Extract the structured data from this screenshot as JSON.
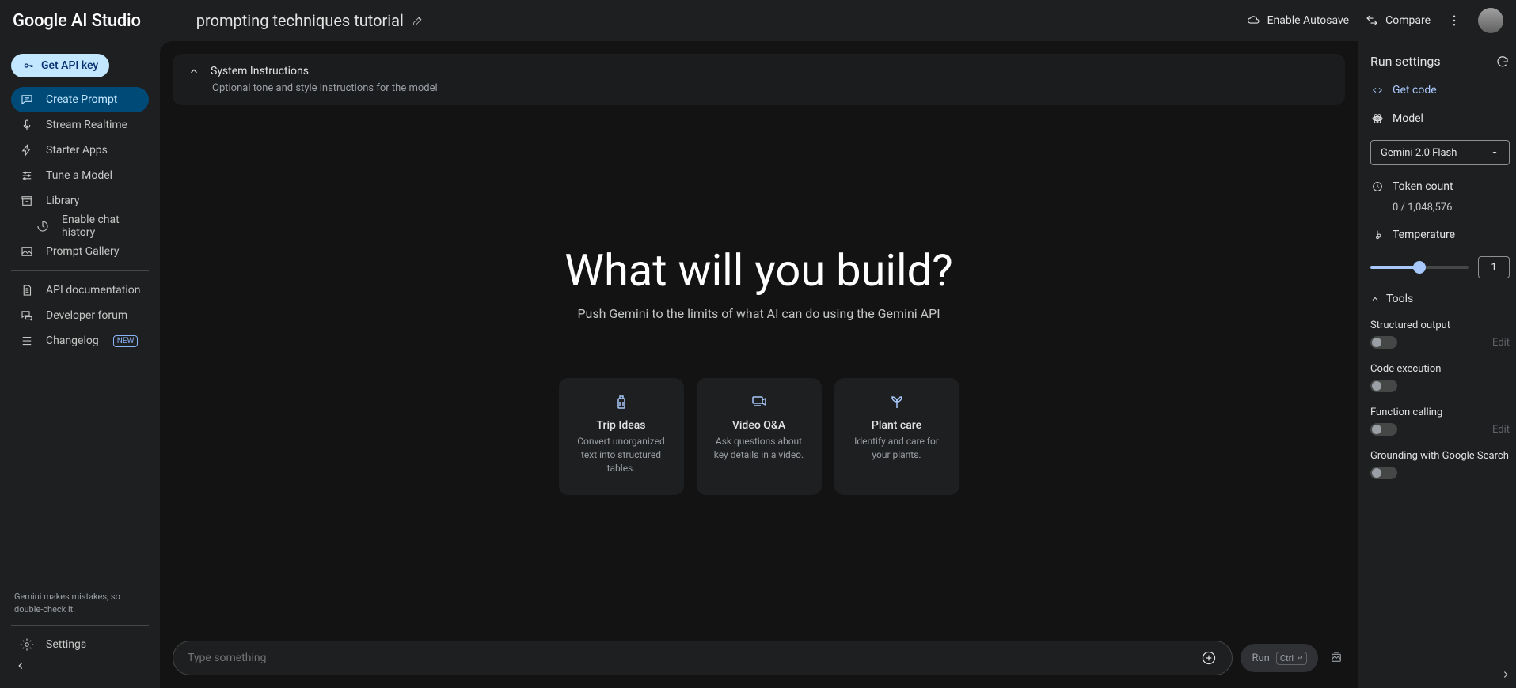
{
  "app": {
    "title": "Google AI Studio"
  },
  "header": {
    "prompt_title": "prompting techniques tutorial",
    "autosave": "Enable Autosave",
    "compare": "Compare"
  },
  "sidebar": {
    "api_key": "Get API key",
    "items": [
      {
        "label": "Create Prompt"
      },
      {
        "label": "Stream Realtime"
      },
      {
        "label": "Starter Apps"
      },
      {
        "label": "Tune a Model"
      },
      {
        "label": "Library"
      },
      {
        "label": "Enable chat history"
      },
      {
        "label": "Prompt Gallery"
      }
    ],
    "secondary": [
      {
        "label": "API documentation"
      },
      {
        "label": "Developer forum"
      },
      {
        "label": "Changelog",
        "badge": "NEW"
      }
    ],
    "disclaimer": "Gemini makes mistakes, so double-check it.",
    "settings": "Settings"
  },
  "main": {
    "system_instructions_title": "System Instructions",
    "system_instructions_sub": "Optional tone and style instructions for the model",
    "hero_title": "What will you build?",
    "hero_sub": "Push Gemini to the limits of what AI can do using the Gemini API",
    "cards": [
      {
        "title": "Trip Ideas",
        "desc": "Convert unorganized text into structured tables."
      },
      {
        "title": "Video Q&A",
        "desc": "Ask questions about key details in a video."
      },
      {
        "title": "Plant care",
        "desc": "Identify and care for your plants."
      }
    ],
    "input_placeholder": "Type something",
    "run": "Run",
    "run_key": "Ctrl"
  },
  "panel": {
    "title": "Run settings",
    "get_code": "Get code",
    "model_label": "Model",
    "model_value": "Gemini 2.0 Flash",
    "token_label": "Token count",
    "token_value": "0 / 1,048,576",
    "temperature_label": "Temperature",
    "temperature_value": "1",
    "tools_label": "Tools",
    "tools": [
      {
        "label": "Structured output",
        "edit": "Edit"
      },
      {
        "label": "Code execution"
      },
      {
        "label": "Function calling",
        "edit": "Edit"
      },
      {
        "label": "Grounding with Google Search"
      }
    ]
  }
}
